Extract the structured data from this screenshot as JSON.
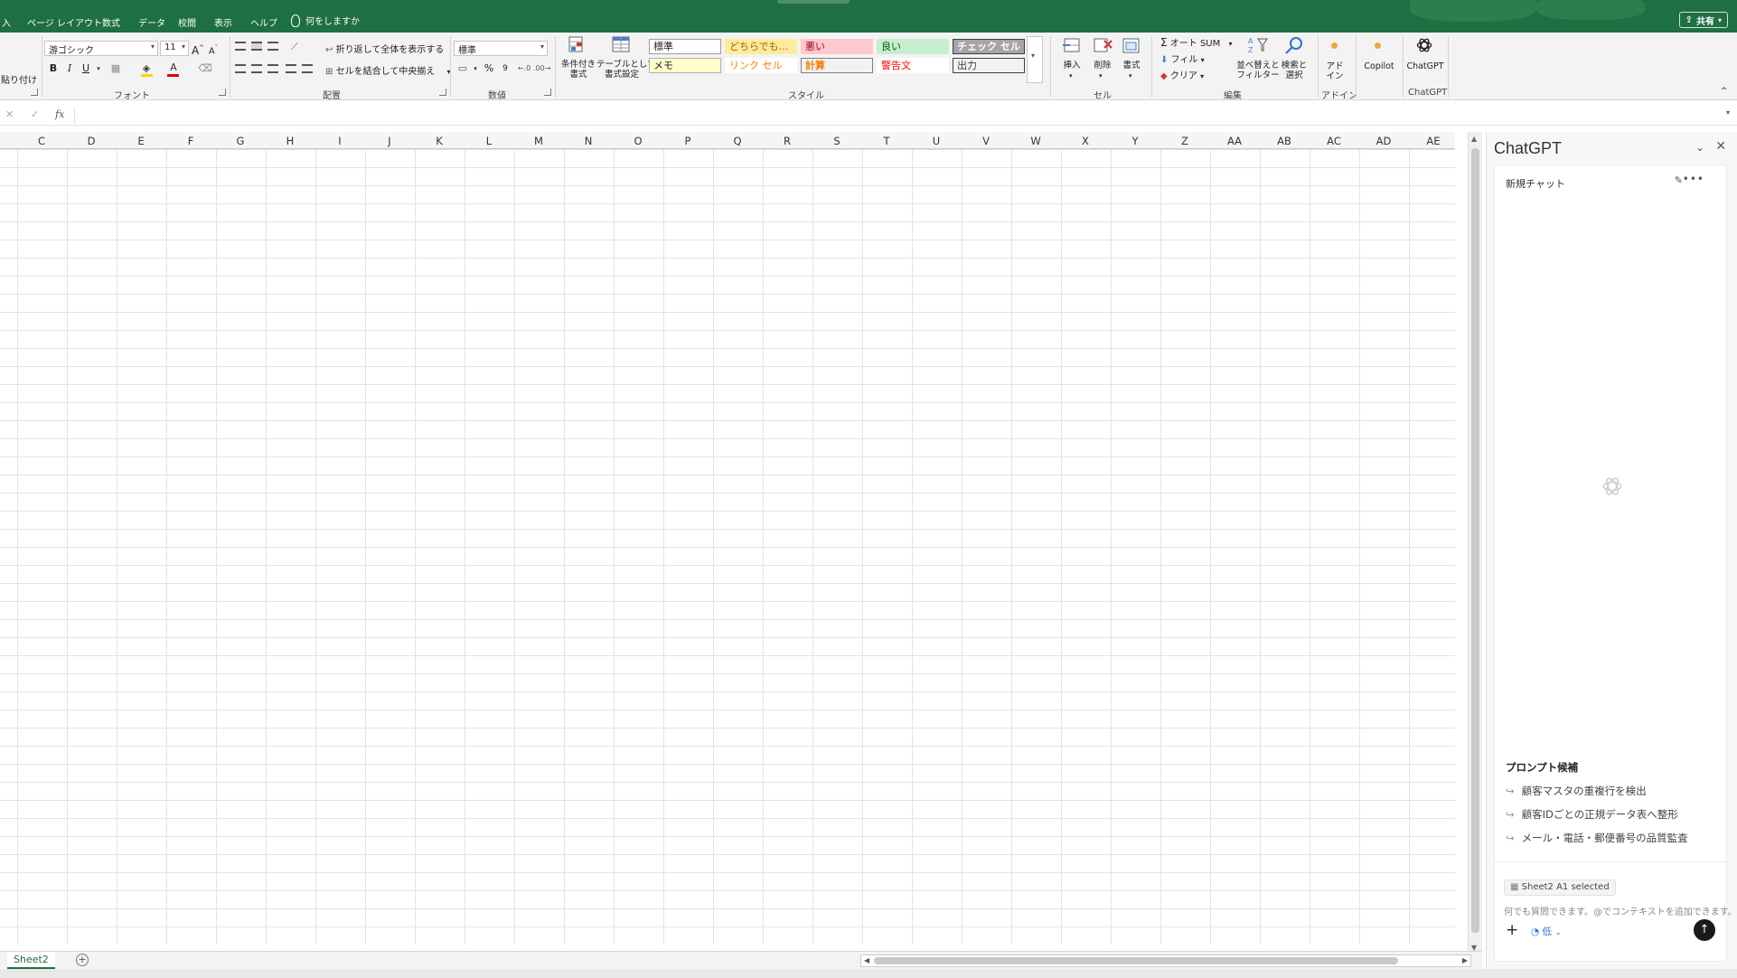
{
  "ribbon_tabs": [
    "入",
    "ページ レイアウト",
    "数式",
    "データ",
    "校閲",
    "表示",
    "ヘルプ"
  ],
  "tell_me": "何をしますか",
  "share_label": "共有",
  "ribbon": {
    "paste_label": "貼り付け",
    "font_name": "游ゴシック",
    "font_size": "11",
    "bold": "B",
    "italic": "I",
    "underline": "U",
    "font_color_letter": "A",
    "wrap_text": "折り返して全体を表示する",
    "merge_center": "セルを結合して中央揃え",
    "number_format": "標準",
    "percent": "%",
    "comma": "9",
    "cond_format": "条件付き\n書式",
    "format_as_table": "テーブルとして\n書式設定",
    "styles": [
      {
        "label": "標準",
        "bg": "#ffffff",
        "fg": "#222222",
        "border": "#9c9c9c",
        "bold": false
      },
      {
        "label": "どちらでも...",
        "bg": "#ffeb9c",
        "fg": "#9c6500",
        "border": "#ffeb9c",
        "bold": false
      },
      {
        "label": "悪い",
        "bg": "#ffc7ce",
        "fg": "#9c0006",
        "border": "#ffc7ce",
        "bold": false
      },
      {
        "label": "良い",
        "bg": "#c6efce",
        "fg": "#006100",
        "border": "#c6efce",
        "bold": false
      },
      {
        "label": "チェック セル",
        "bg": "#a5a5a5",
        "fg": "#ffffff",
        "border": "#3f3f3f",
        "bold": true
      },
      {
        "label": "メモ",
        "bg": "#ffffcc",
        "fg": "#222222",
        "border": "#b2b2b2",
        "bold": false
      },
      {
        "label": "リンク セル",
        "bg": "#ffffff",
        "fg": "#fa7d00",
        "border": "#ffffff",
        "bold": false
      },
      {
        "label": "計算",
        "bg": "#f2f2f2",
        "fg": "#fa7d00",
        "border": "#7f7f7f",
        "bold": true
      },
      {
        "label": "警告文",
        "bg": "#ffffff",
        "fg": "#ff0000",
        "border": "#ffffff",
        "bold": false
      },
      {
        "label": "出力",
        "bg": "#f2f2f2",
        "fg": "#3f3f3f",
        "border": "#3f3f3f",
        "bold": false
      }
    ],
    "insert": "挿入",
    "delete": "削除",
    "format": "書式",
    "autosum": "オート SUM",
    "fill": "フィル",
    "clear": "クリア",
    "sort_filter": "並べ替えと\nフィルター",
    "find_select": "検索と\n選択",
    "addins": "アド\nイン",
    "copilot": "Copilot",
    "chatgpt": "ChatGPT",
    "groups": {
      "font": "フォント",
      "alignment": "配置",
      "number": "数値",
      "styles": "スタイル",
      "cells": "セル",
      "editing": "編集",
      "addins": "アドイン",
      "chatgpt": "ChatGPT"
    }
  },
  "formula_bar": {
    "fx": "fx",
    "value": ""
  },
  "columns": [
    "C",
    "D",
    "E",
    "F",
    "G",
    "H",
    "I",
    "J",
    "K",
    "L",
    "M",
    "N",
    "O",
    "P",
    "Q",
    "R",
    "S",
    "T",
    "U",
    "V",
    "W",
    "X",
    "Y",
    "Z",
    "AA",
    "AB",
    "AC",
    "AD",
    "AE"
  ],
  "sheet_tab": "Sheet2",
  "chat": {
    "title": "ChatGPT",
    "new_chat": "新規チャット",
    "suggestions_title": "プロンプト候補",
    "suggestions": [
      "顧客マスタの重複行を検出",
      "顧客IDごとの正規データ表へ整形",
      "メール・電話・郵便番号の品質監査"
    ],
    "context_chip": "Sheet2 A1 selected",
    "input_placeholder": "何でも質問できます。@でコンテキストを追加できます。",
    "effort_label": "低"
  },
  "colors": {
    "excel_green": "#1e6f42"
  }
}
